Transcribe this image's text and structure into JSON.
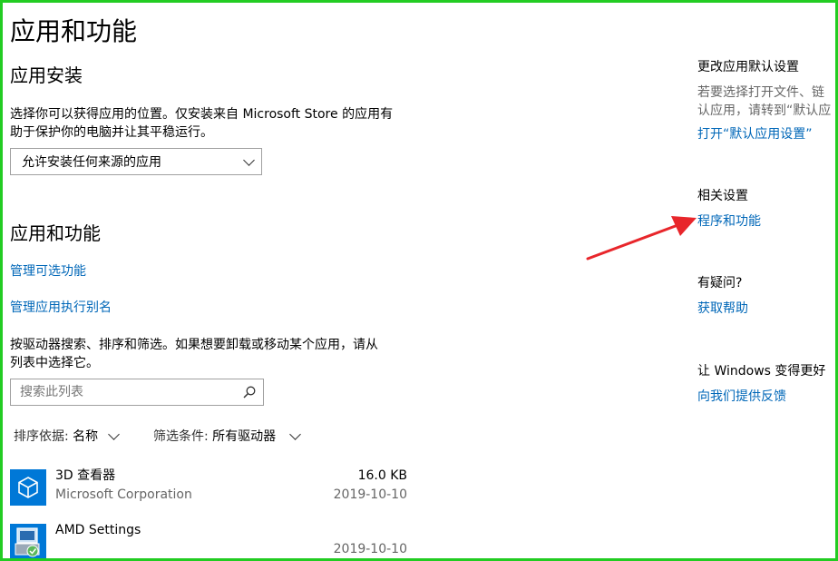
{
  "page_title": "应用和功能",
  "install": {
    "heading": "应用安装",
    "description_line1": "选择你可以获得应用的位置。仅安装来自 Microsoft Store 的应用有",
    "description_line2": "助于保护你的电脑并让其平稳运行。",
    "dropdown_value": "允许安装任何来源的应用"
  },
  "apps": {
    "heading": "应用和功能",
    "link_optional_features": "管理可选功能",
    "link_aliases": "管理应用执行别名",
    "search_desc_line1": "按驱动器搜索、排序和筛选。如果想要卸载或移动某个应用，请从",
    "search_desc_line2": "列表中选择它。",
    "search_placeholder": "搜索此列表",
    "sort_label": "排序依据:",
    "sort_value": "名称",
    "filter_label": "筛选条件:",
    "filter_value": "所有驱动器",
    "list": [
      {
        "name": "3D 查看器",
        "publisher": "Microsoft Corporation",
        "size": "16.0 KB",
        "date": "2019-10-10",
        "icon": "cube-icon"
      },
      {
        "name": "AMD Settings",
        "publisher": "",
        "size": "",
        "date": "2019-10-10",
        "icon": "installer-icon"
      }
    ]
  },
  "sidebar": {
    "default_apps_heading": "更改应用默认设置",
    "default_apps_text_line1": "若要选择打开文件、链",
    "default_apps_text_line2": "认应用，请转到“默认应",
    "default_apps_link": "打开“默认应用设置”",
    "related_heading": "相关设置",
    "related_link": "程序和功能",
    "question_heading": "有疑问?",
    "help_link": "获取帮助",
    "feedback_heading": "让 Windows 变得更好",
    "feedback_link": "向我们提供反馈"
  },
  "colors": {
    "accent_link": "#0067b8",
    "app_icon_bg": "#0078d7",
    "annotation_arrow": "#e8262b",
    "frame_border": "#22cc22"
  }
}
